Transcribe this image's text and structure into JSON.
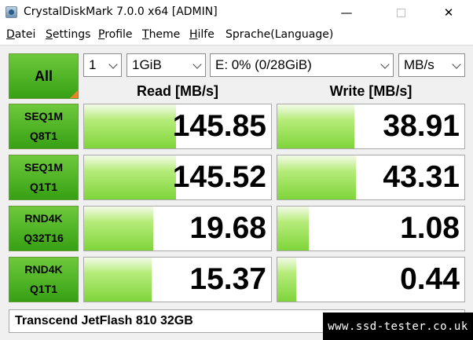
{
  "window": {
    "title": "CrystalDiskMark 7.0.0 x64 [ADMIN]",
    "minimize_glyph": "—",
    "close_glyph": "✕"
  },
  "menu": {
    "items": [
      {
        "mnemonic": "D",
        "rest": "atei"
      },
      {
        "mnemonic": "S",
        "rest": "ettings"
      },
      {
        "mnemonic": "P",
        "rest": "rofile"
      },
      {
        "mnemonic": "T",
        "rest": "heme"
      },
      {
        "mnemonic": "H",
        "rest": "ilfe"
      },
      {
        "mnemonic": "",
        "rest": "Sprache(Language)"
      }
    ]
  },
  "controls": {
    "all_button": "All",
    "test_count": "1",
    "test_size": "1GiB",
    "drive": "E: 0% (0/28GiB)",
    "unit": "MB/s"
  },
  "headers": {
    "read": "Read [MB/s]",
    "write": "Write [MB/s]"
  },
  "tests": [
    {
      "line1": "SEQ1M",
      "line2": "Q8T1",
      "read": "145.85",
      "write": "38.91",
      "read_fill": 0.49,
      "write_fill": 0.41
    },
    {
      "line1": "SEQ1M",
      "line2": "Q1T1",
      "read": "145.52",
      "write": "43.31",
      "read_fill": 0.49,
      "write_fill": 0.42
    },
    {
      "line1": "RND4K",
      "line2": "Q32T16",
      "read": "19.68",
      "write": "1.08",
      "read_fill": 0.37,
      "write_fill": 0.17
    },
    {
      "line1": "RND4K",
      "line2": "Q1T1",
      "read": "15.37",
      "write": "0.44",
      "read_fill": 0.36,
      "write_fill": 0.1
    }
  ],
  "comment": "Transcend JetFlash 810 32GB",
  "watermark": "www.ssd-tester.co.uk",
  "colors": {
    "accent_green": "#37a014",
    "corner_orange": "#e8842a"
  }
}
